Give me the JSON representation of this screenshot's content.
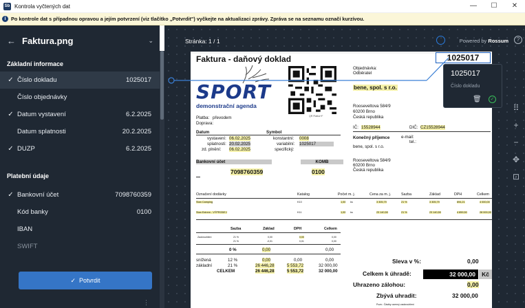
{
  "window": {
    "title": "Kontrola vyčtených dat",
    "app_icon": "Sb",
    "controls": [
      "—",
      "☐",
      "✕"
    ]
  },
  "info_bar": {
    "icon": "info-icon",
    "text": "Po kontrole dat s případnou opravou a jejím potvrzení (viz tlačítko „Potvrdit\") vyčkejte na aktualizaci zprávy. Zpráva se na seznamu označí kurzívou."
  },
  "sidebar": {
    "back": "←",
    "file_name": "Faktura.png",
    "sections": [
      {
        "title": "Základní informace",
        "items": [
          {
            "label": "Číslo dokladu",
            "value": "1025017",
            "checked": true,
            "active": true
          },
          {
            "label": "Číslo objednávky",
            "value": "",
            "checked": false
          },
          {
            "label": "Datum vystavení",
            "value": "6.2.2025",
            "checked": true
          },
          {
            "label": "Datum splatnosti",
            "value": "20.2.2025",
            "checked": false
          },
          {
            "label": "DUZP",
            "value": "6.2.2025",
            "checked": true
          }
        ]
      },
      {
        "title": "Platební údaje",
        "items": [
          {
            "label": "Bankovní účet",
            "value": "7098760359",
            "checked": true
          },
          {
            "label": "Kód banky",
            "value": "0100",
            "checked": false
          },
          {
            "label": "IBAN",
            "value": "",
            "checked": false
          },
          {
            "label": "SWIFT",
            "value": "",
            "checked": false
          }
        ]
      }
    ],
    "confirm_label": "Potvrdit",
    "more": "⋮"
  },
  "viewer": {
    "page_label": "Stránka: 1 / 1",
    "powered_prefix": "Powered by",
    "powered_brand": "Rossum"
  },
  "popup": {
    "value": "1025017",
    "label": "Číslo dokladu"
  },
  "document": {
    "title": "Faktura - daňový doklad",
    "invoice_number": "1025017",
    "logo": "SPORT",
    "tagline": "demonstrační agenda",
    "payment_label": "Platba:",
    "payment_value": "převodem",
    "delivery_label": "Doprava:",
    "date_header": "Datum",
    "symbol_header": "Symbol",
    "dates": [
      {
        "label": "vystavení:",
        "value": "06.02.2025"
      },
      {
        "label": "splatnosti:",
        "value": "20.02.2025"
      },
      {
        "label": "zd. plnění:",
        "value": "06.02.2025"
      }
    ],
    "symbols": [
      {
        "label": "konstantní:",
        "value": "0008"
      },
      {
        "label": "variabilní:",
        "value": "1025017"
      },
      {
        "label": "specifický:",
        "value": ""
      }
    ],
    "qr_caption": "QR Platba+F",
    "orderer_label": "Objednávka:",
    "customer_label": "Odběratel",
    "customer_name": "bene, spol. s r.o.",
    "customer_address": [
      "Rooseveltova 584/9",
      "60200 Brno",
      "Česká republika"
    ],
    "ic_label": "IČ:",
    "ic_value": "15528944",
    "dic_label": "DIČ:",
    "dic_value": "CZ15528944",
    "final_recipient_label": "Konečný příjemce",
    "email_label": "e-mail:",
    "tel_label": "tel.:",
    "recipient_name": "bene, spol. s r.o.",
    "recipient_address": [
      "Rooseveltova 584/9",
      "60200 Brno",
      "Česká republika"
    ],
    "bank_label": "Bankovní účet",
    "bank_account": "7098760359",
    "komb_label": "KOMB",
    "bank_code": "0100",
    "items_headers": [
      "Označení dodávky",
      "Katalog",
      "Počet m. j.",
      "Cena za m. j.",
      "Sazba",
      "Základ",
      "DPH",
      "Celkem"
    ],
    "items": [
      {
        "name": "Stan Camping",
        "catalog": "K10",
        "qty": "1,00",
        "unit": "ks",
        "price": "3 305,79",
        "rate": "21 %",
        "base": "3 305,79",
        "vat": "694,21",
        "total": "4 000,00"
      },
      {
        "name": "Stan Extrem - VÝPRODEJ",
        "catalog": "K11",
        "qty": "1,00",
        "unit": "ks",
        "price": "23 140,50",
        "rate": "21 %",
        "base": "23 140,50",
        "vat": "4 859,50",
        "total": "28 000,00"
      }
    ],
    "vat_table": {
      "headers": [
        "Sazba",
        "Základ",
        "DPH",
        "Celkem"
      ],
      "rows": [
        {
          "label": "Zaokrouhlení",
          "rate": "21 %",
          "base": "0,00",
          "vat": "0,00",
          "total": "0,00"
        },
        {
          "label": "",
          "rate": "21 %",
          "base": "-0,01",
          "vat": "0,01",
          "total": "0,00"
        },
        {
          "label": "",
          "rate": "0 %",
          "base": "0,00",
          "vat": "",
          "total": "0,00"
        },
        {
          "label": "snížená",
          "rate": "12 %",
          "base": "0,00",
          "vat": "0,00",
          "total": "0,00"
        },
        {
          "label": "základní",
          "rate": "21 %",
          "base": "26 446,28",
          "vat": "5 553,72",
          "total": "32 000,00"
        },
        {
          "label": "",
          "rate": "CELKEM",
          "base": "26 446,28",
          "vat": "5 553,72",
          "total": "32 000,00"
        }
      ]
    },
    "discount_label": "Sleva v %:",
    "discount_value": "0,00",
    "total_label": "Celkem k úhradě:",
    "total_value": "32 000,00",
    "currency": "Kč",
    "paid_label": "Uhrazeno zálohou:",
    "paid_value": "0,00",
    "remaining_label": "Zbývá uhradit:",
    "remaining_value": "32 000,00",
    "rounding_note": "Pozn.: Částky ocenný zaokrouhlení"
  },
  "colors": {
    "sidebar_bg": "#1f2833",
    "accent": "#3575c6",
    "highlight": "#f5f1a8"
  }
}
